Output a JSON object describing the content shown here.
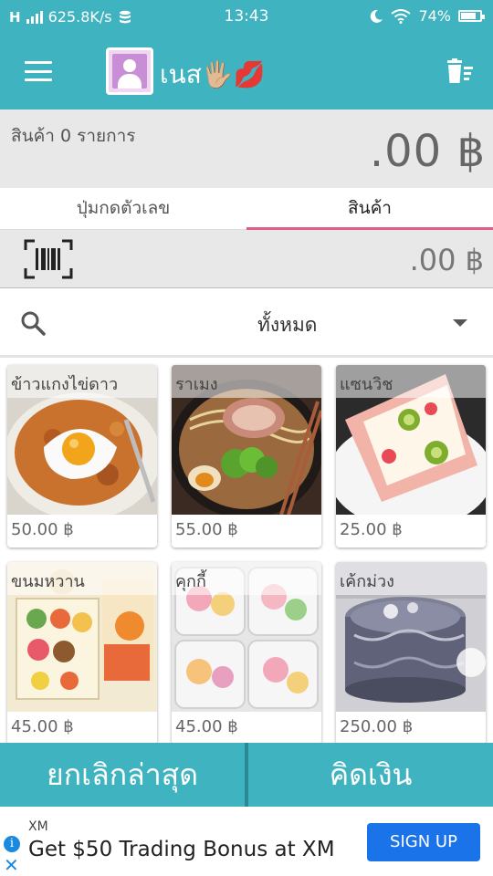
{
  "status_bar": {
    "network_speed": "625.8K/s",
    "time": "13:43",
    "battery": "74%"
  },
  "app_bar": {
    "user_name": "เนส🖐🏼💋",
    "icons": {
      "menu": "hamburger-menu-icon",
      "profile": "avatar-icon",
      "clear": "clear-list-icon"
    }
  },
  "summary": {
    "item_count_label": "สินค้า 0 รายการ",
    "total_amount": ".00 ฿"
  },
  "tabs": [
    {
      "label": "ปุ่มกดตัวเลข",
      "active": false
    },
    {
      "label": "สินค้า",
      "active": true
    }
  ],
  "barcode": {
    "amount": ".00 ฿"
  },
  "filter": {
    "category": "ทั้งหมด"
  },
  "products": [
    {
      "name": "ข้าวแกงไข่ดาว",
      "price": "50.00 ฿"
    },
    {
      "name": "ราเมง",
      "price": "55.00 ฿"
    },
    {
      "name": "แซนวิช",
      "price": "25.00 ฿"
    },
    {
      "name": "ขนมหวาน",
      "price": "45.00 ฿"
    },
    {
      "name": "คุกกี้",
      "price": "45.00 ฿"
    },
    {
      "name": "เค้กม่วง",
      "price": "250.00 ฿"
    }
  ],
  "actions": {
    "cancel_label": "ยกเลิกล่าสุด",
    "checkout_label": "คิดเงิน"
  },
  "ad": {
    "brand": "XM",
    "headline": "Get $50 Trading Bonus at XM",
    "cta": "SIGN UP"
  },
  "colors": {
    "primary": "#3fb3bf",
    "tab_indicator": "#e05a8a",
    "ad_button": "#1a73e8"
  }
}
